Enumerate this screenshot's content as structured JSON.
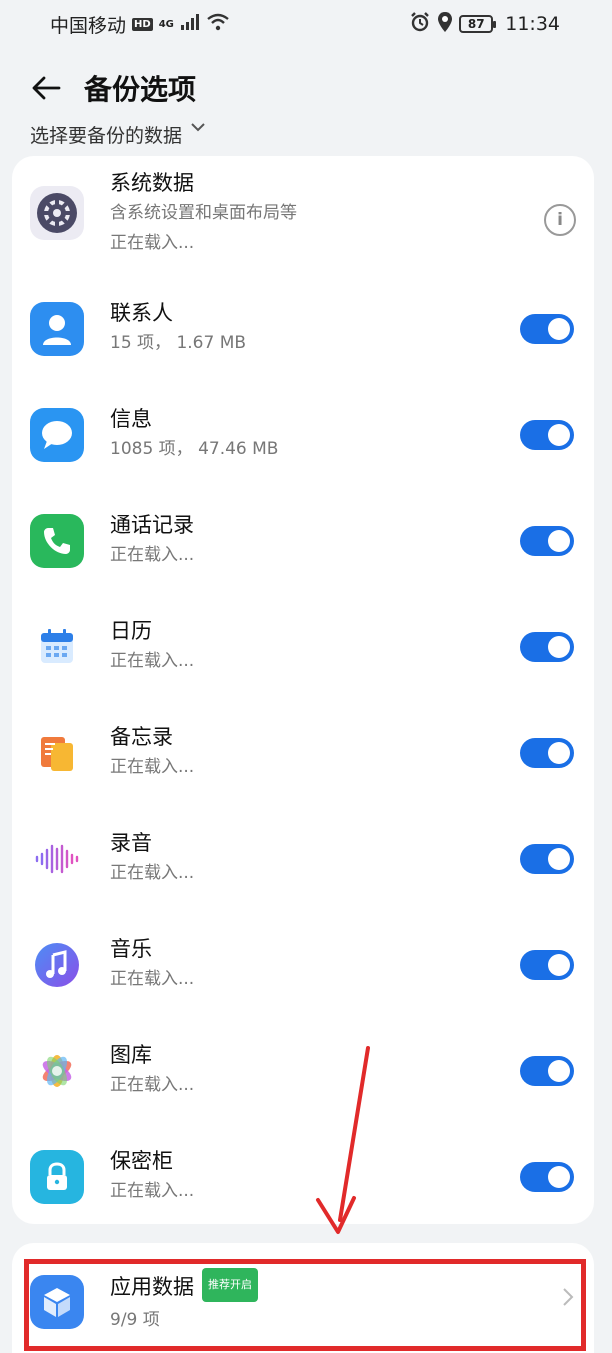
{
  "status_bar": {
    "carrier": "中国移动",
    "hd": "HD",
    "network": "4G",
    "battery": "87",
    "time": "11:34"
  },
  "header": {
    "title": "备份选项"
  },
  "section": {
    "label": "选择要备份的数据"
  },
  "items": [
    {
      "title": "系统数据",
      "subtitle": "含系统设置和桌面布局等",
      "status": "正在载入...",
      "control": "info",
      "icon": "system-data-icon"
    },
    {
      "title": "联系人",
      "subtitle": "15 项， 1.67 MB",
      "control": "toggle",
      "on": true,
      "icon": "contacts-icon"
    },
    {
      "title": "信息",
      "subtitle": "1085 项， 47.46 MB",
      "control": "toggle",
      "on": true,
      "icon": "messages-icon"
    },
    {
      "title": "通话记录",
      "subtitle": "正在载入...",
      "control": "toggle",
      "on": true,
      "icon": "phone-icon"
    },
    {
      "title": "日历",
      "subtitle": "正在载入...",
      "control": "toggle",
      "on": true,
      "icon": "calendar-icon"
    },
    {
      "title": "备忘录",
      "subtitle": "正在载入...",
      "control": "toggle",
      "on": true,
      "icon": "notes-icon"
    },
    {
      "title": "录音",
      "subtitle": "正在载入...",
      "control": "toggle",
      "on": true,
      "icon": "recorder-icon"
    },
    {
      "title": "音乐",
      "subtitle": "正在载入...",
      "control": "toggle",
      "on": true,
      "icon": "music-icon"
    },
    {
      "title": "图库",
      "subtitle": "正在载入...",
      "control": "toggle",
      "on": true,
      "icon": "gallery-icon"
    },
    {
      "title": "保密柜",
      "subtitle": "正在载入...",
      "control": "toggle",
      "on": true,
      "icon": "safe-icon"
    }
  ],
  "app_data": {
    "title": "应用数据",
    "tag": "推荐开启",
    "subtitle": "9/9 项",
    "icon": "app-data-icon"
  },
  "colors": {
    "accent": "#1a6fe6",
    "highlight": "#e12a2a",
    "tag": "#2fb55c"
  }
}
